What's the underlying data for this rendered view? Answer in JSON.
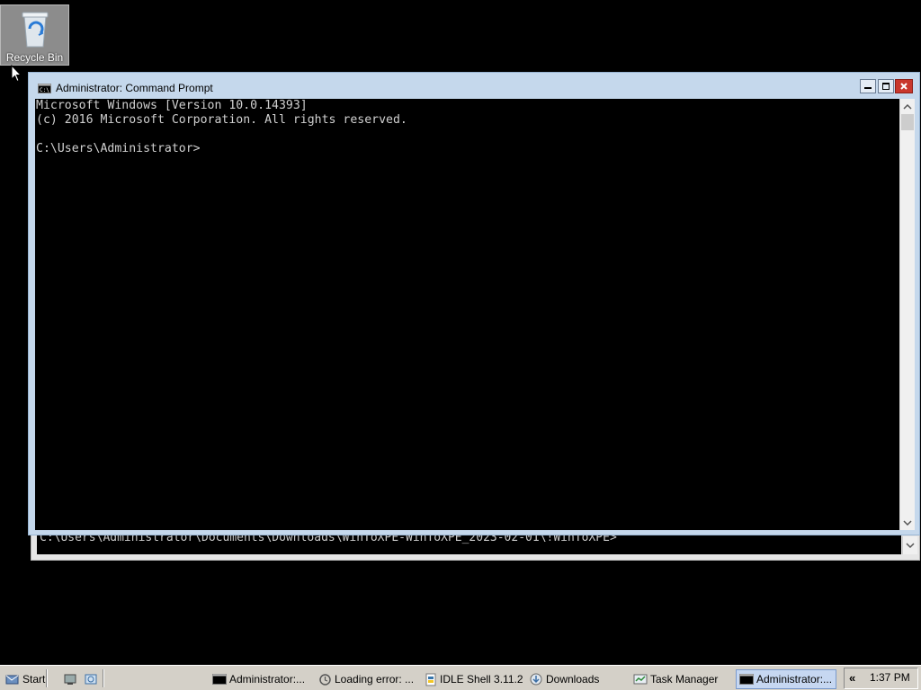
{
  "desktop": {
    "recycle_bin_label": "Recycle Bin"
  },
  "back_window": {
    "console_line": "C:\\Users\\Administrator\\Documents\\Downloads\\WinToXPE-WinToXPE_2023-02-01\\!WinToXPE>"
  },
  "cmd_window": {
    "title": "Administrator: Command Prompt",
    "lines": [
      "Microsoft Windows [Version 10.0.14393]",
      "(c) 2016 Microsoft Corporation. All rights reserved.",
      "C:\\Users\\Administrator>"
    ]
  },
  "taskbar": {
    "start_label": "Start",
    "tasks": [
      {
        "label": "Administrator:...",
        "icon": "console-icon"
      },
      {
        "label": "Loading error: ...",
        "icon": "loading-icon"
      },
      {
        "label": "IDLE Shell 3.11.2",
        "icon": "python-icon"
      },
      {
        "label": "Downloads",
        "icon": "folder-icon"
      },
      {
        "label": "Task Manager",
        "icon": "task-manager-icon"
      },
      {
        "label": "Administrator:...",
        "icon": "console-icon"
      }
    ],
    "tray_chevron": "«",
    "clock": "1:37 PM"
  },
  "colors": {
    "title_bar": "#c5d8ec",
    "close_button": "#c9372c",
    "console_bg": "#000000",
    "console_text": "#d0d0d0"
  }
}
